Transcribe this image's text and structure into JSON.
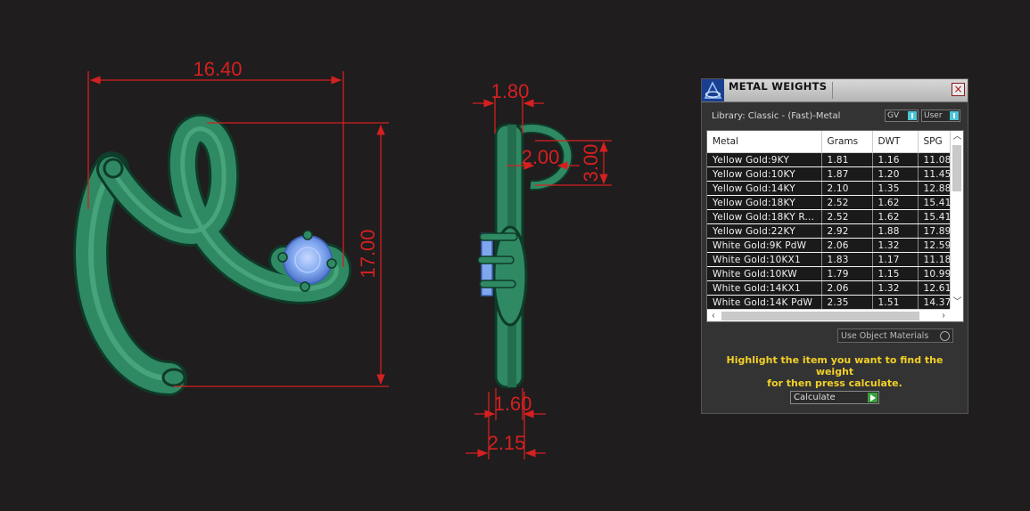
{
  "dimensions": {
    "width_label": "16.40",
    "height_label": "17.00",
    "side_top": "1.80",
    "side_bail_width": "2.00",
    "side_bail_height": "3.00",
    "side_bottom_inner": "1.60",
    "side_bottom_outer": "2.15"
  },
  "colors": {
    "dimension_line": "#d42020",
    "metal_green": "#2f8a63",
    "gem_blue": "#7fa7ee",
    "background": "#1f1d1e"
  },
  "panel": {
    "title": "METAL WEIGHTS",
    "close_icon": "close-icon",
    "library_label": "Library: Classic - (Fast)-Metal",
    "gv_toggle": "GV",
    "user_toggle": "User",
    "table": {
      "headers": [
        "Metal",
        "Grams",
        "DWT",
        "SPG"
      ],
      "rows": [
        [
          "Yellow Gold:9KY",
          "1.81",
          "1.16",
          "11.08"
        ],
        [
          "Yellow Gold:10KY",
          "1.87",
          "1.20",
          "11.45"
        ],
        [
          "Yellow Gold:14KY",
          "2.10",
          "1.35",
          "12.88"
        ],
        [
          "Yellow Gold:18KY",
          "2.52",
          "1.62",
          "15.41"
        ],
        [
          "Yellow Gold:18KY R...",
          "2.52",
          "1.62",
          "15.41"
        ],
        [
          "Yellow Gold:22KY",
          "2.92",
          "1.88",
          "17.89"
        ],
        [
          "White Gold:9K PdW",
          "2.06",
          "1.32",
          "12.59"
        ],
        [
          "White Gold:10KX1",
          "1.83",
          "1.17",
          "11.18"
        ],
        [
          "White Gold:10KW",
          "1.79",
          "1.15",
          "10.99"
        ],
        [
          "White Gold:14KX1",
          "2.06",
          "1.32",
          "12.61"
        ],
        [
          "White Gold:14K PdW",
          "2.35",
          "1.51",
          "14.37"
        ]
      ]
    },
    "use_object_materials": "Use Object Materials",
    "hint_line1": "Highlight the item you want to find the weight",
    "hint_line2": "for then press calculate.",
    "calculate_label": "Calculate"
  }
}
